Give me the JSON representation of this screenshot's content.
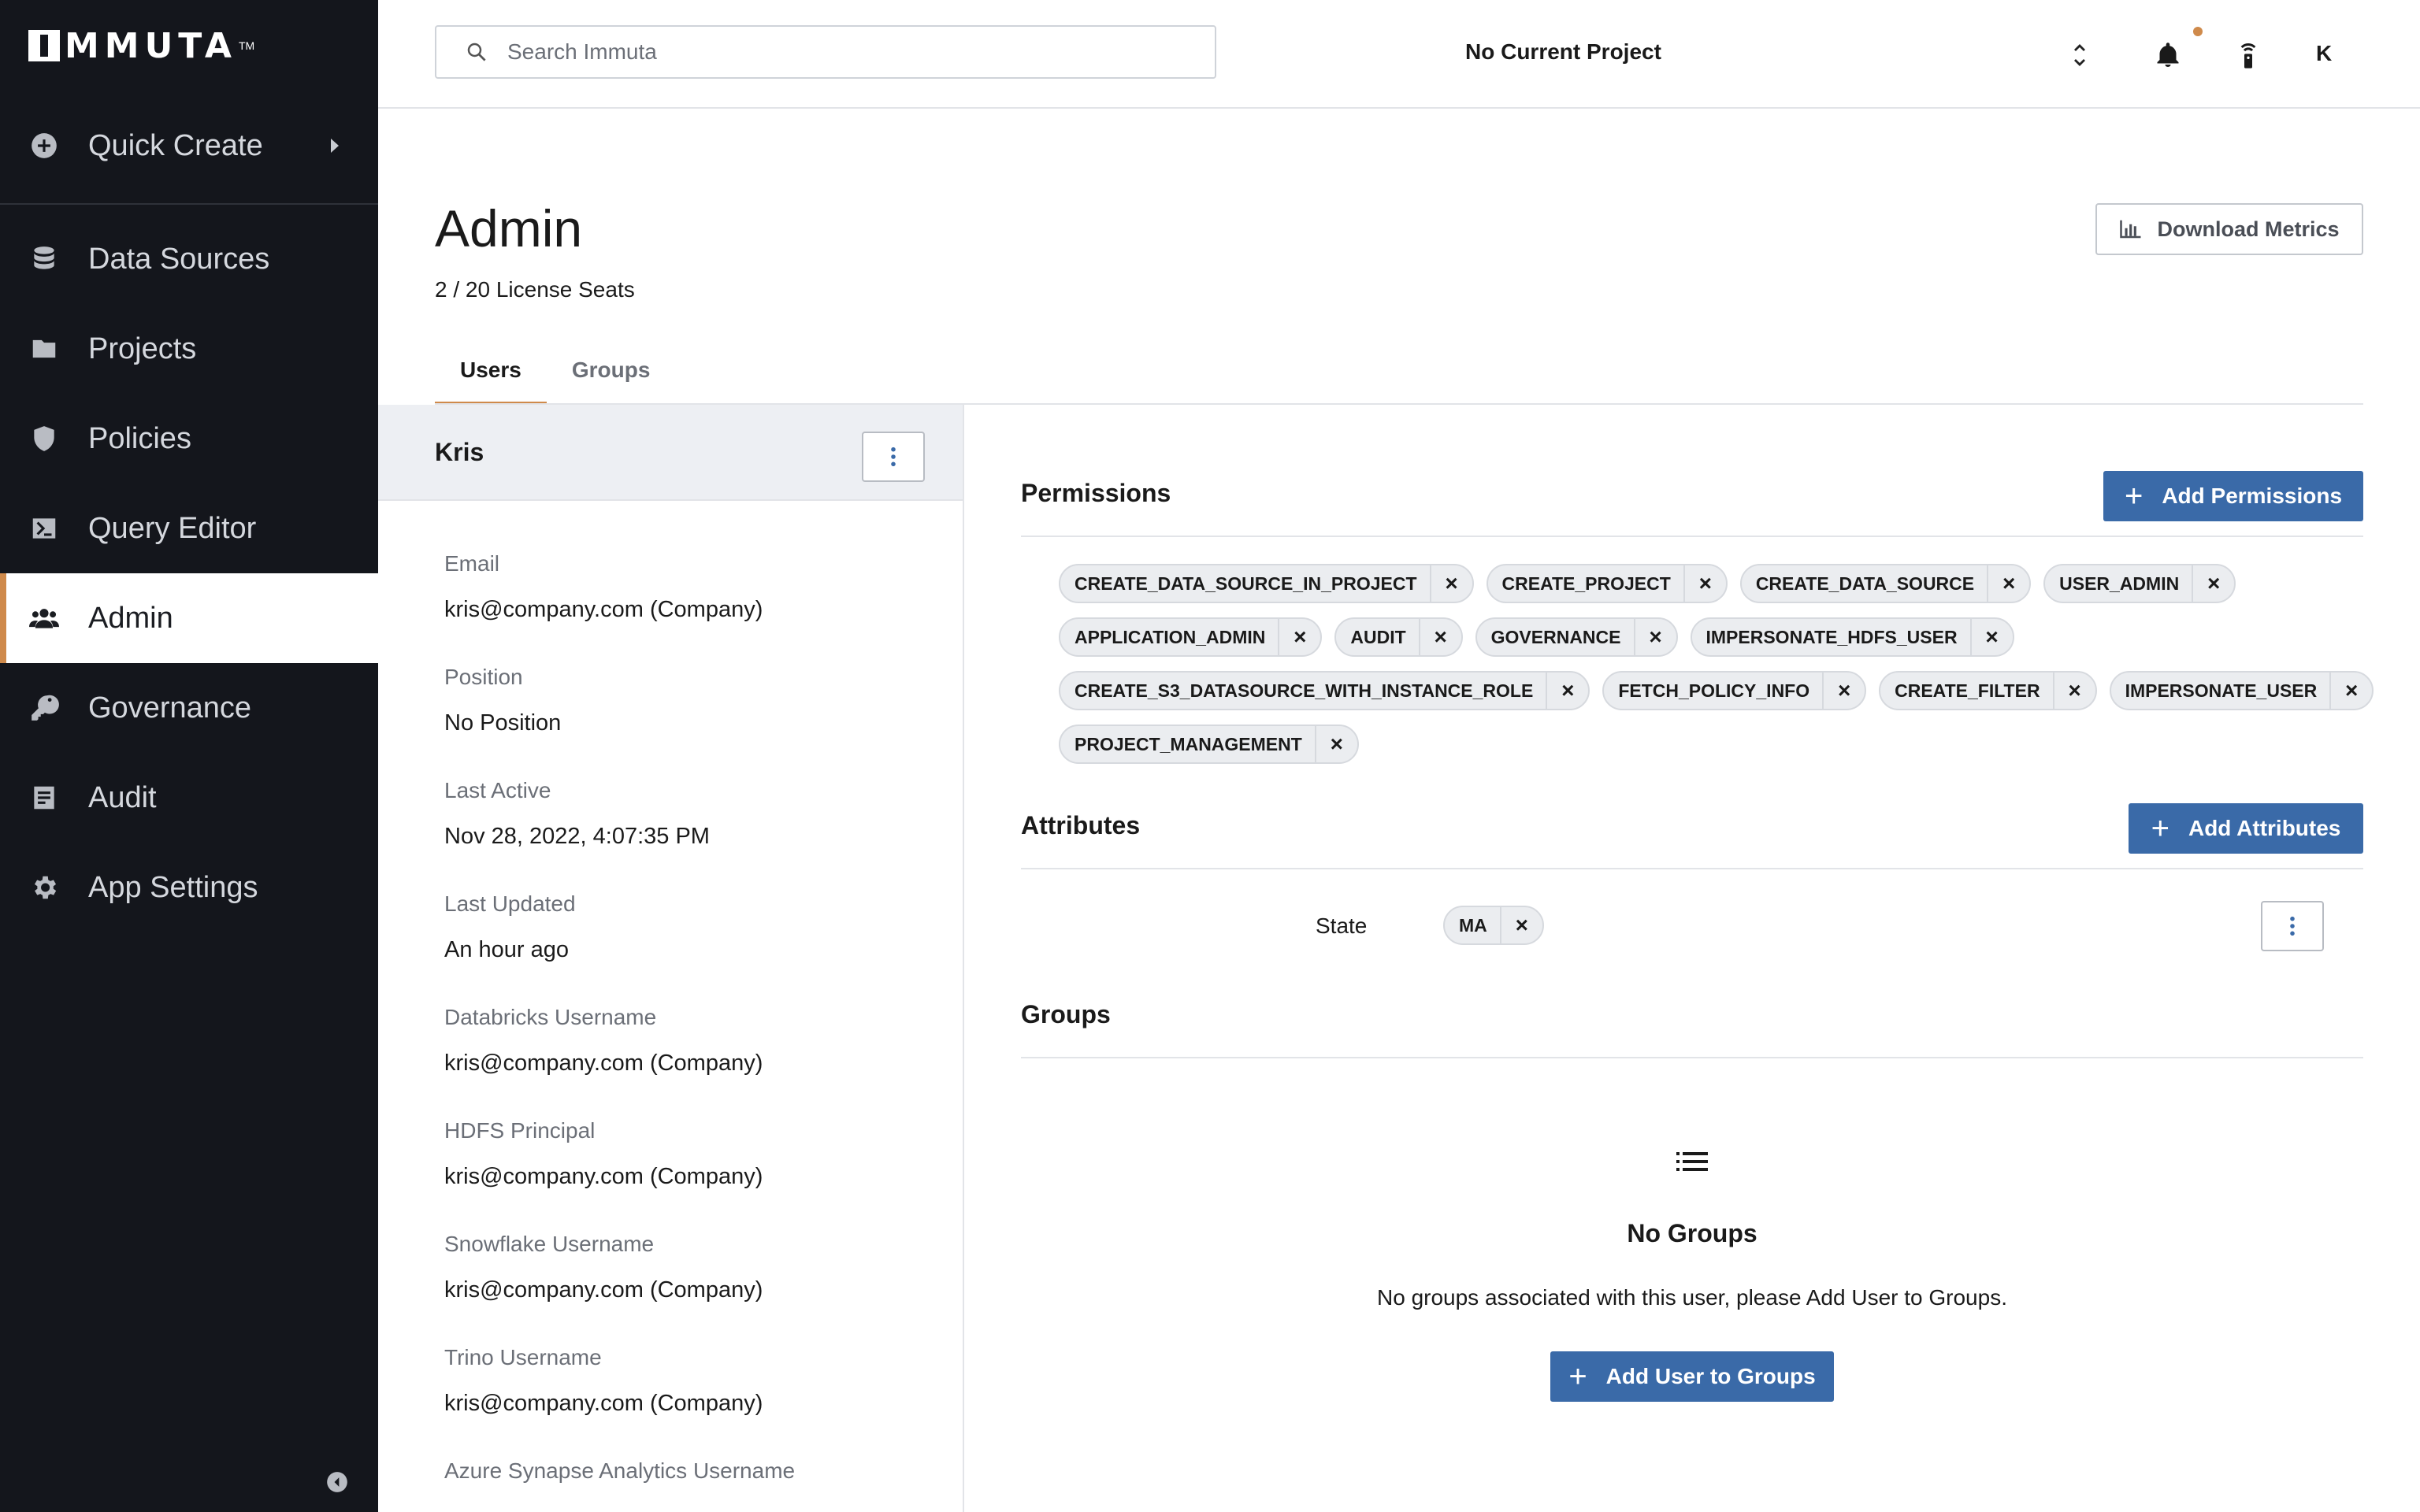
{
  "brand": {
    "name": "MMUTA",
    "tm": "TM"
  },
  "sidebar": {
    "quick_create": "Quick Create",
    "items": [
      {
        "label": "Data Sources",
        "icon": "database-icon"
      },
      {
        "label": "Projects",
        "icon": "folder-icon"
      },
      {
        "label": "Policies",
        "icon": "shield-icon"
      },
      {
        "label": "Query Editor",
        "icon": "terminal-icon"
      },
      {
        "label": "Admin",
        "icon": "users-icon",
        "active": true
      },
      {
        "label": "Governance",
        "icon": "key-icon"
      },
      {
        "label": "Audit",
        "icon": "audit-icon"
      },
      {
        "label": "App Settings",
        "icon": "gear-icon"
      }
    ]
  },
  "topbar": {
    "search_placeholder": "Search Immuta",
    "project": "No Current Project",
    "avatar": "K"
  },
  "page": {
    "title": "Admin",
    "license": "2 / 20 License Seats",
    "download_label": "Download Metrics",
    "tabs": [
      "Users",
      "Groups"
    ]
  },
  "user": {
    "name": "Kris",
    "fields": [
      {
        "label": "Email",
        "value": "kris@company.com (Company)"
      },
      {
        "label": "Position",
        "value": "No Position"
      },
      {
        "label": "Last Active",
        "value": "Nov 28, 2022, 4:07:35 PM"
      },
      {
        "label": "Last Updated",
        "value": "An hour ago"
      },
      {
        "label": "Databricks Username",
        "value": "kris@company.com (Company)"
      },
      {
        "label": "HDFS Principal",
        "value": "kris@company.com (Company)"
      },
      {
        "label": "Snowflake Username",
        "value": "kris@company.com (Company)"
      },
      {
        "label": "Trino Username",
        "value": "kris@company.com (Company)"
      },
      {
        "label": "Azure Synapse Analytics Username",
        "value": ""
      }
    ]
  },
  "permissions": {
    "title": "Permissions",
    "add_label": "Add Permissions",
    "rows": [
      [
        "CREATE_DATA_SOURCE_IN_PROJECT",
        "CREATE_PROJECT",
        "CREATE_DATA_SOURCE",
        "USER_ADMIN"
      ],
      [
        "APPLICATION_ADMIN",
        "AUDIT",
        "GOVERNANCE",
        "IMPERSONATE_HDFS_USER"
      ],
      [
        "CREATE_S3_DATASOURCE_WITH_INSTANCE_ROLE",
        "FETCH_POLICY_INFO",
        "CREATE_FILTER",
        "IMPERSONATE_USER"
      ],
      [
        "PROJECT_MANAGEMENT"
      ]
    ]
  },
  "attributes": {
    "title": "Attributes",
    "add_label": "Add Attributes",
    "key": "State",
    "value": "MA"
  },
  "groups": {
    "title": "Groups",
    "empty_title": "No Groups",
    "empty_desc": "No groups associated with this user, please Add User to Groups.",
    "add_label": "Add User to Groups"
  },
  "colors": {
    "sidebar_bg": "#14161c",
    "accent": "#cf8a4b",
    "primary": "#3a6aa8"
  }
}
